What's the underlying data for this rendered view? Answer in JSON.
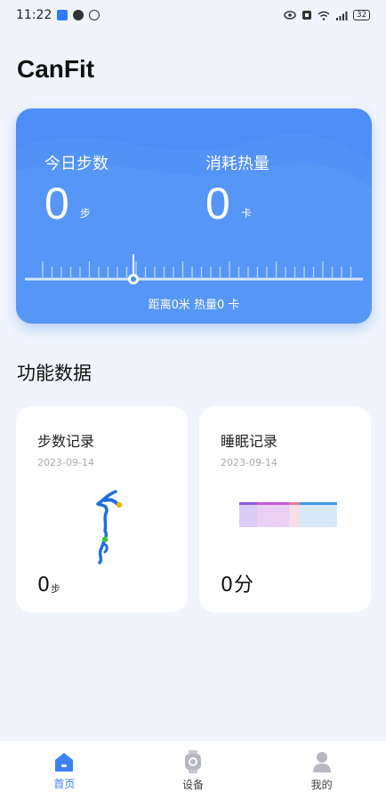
{
  "status_bar": {
    "time": "11:22",
    "battery": "32"
  },
  "app": {
    "title": "CanFit"
  },
  "hero": {
    "steps_label": "今日步数",
    "steps_value": "0",
    "steps_unit": "步",
    "calories_label": "消耗热量",
    "calories_value": "0",
    "calories_unit": "卡",
    "ruler_caption": "距离0米 热量0 卡"
  },
  "section": {
    "title": "功能数据"
  },
  "cards": {
    "steps": {
      "title": "步数记录",
      "date": "2023-09-14",
      "value": "0",
      "unit": "步"
    },
    "sleep": {
      "title": "睡眠记录",
      "date": "2023-09-14",
      "value": "0",
      "unit": "分"
    }
  },
  "nav": {
    "home": "首页",
    "device": "设备",
    "mine": "我的"
  },
  "colors": {
    "accent": "#3d82f4",
    "hero_bg": "#4d8ef6",
    "page_bg": "#f1f4fb"
  }
}
